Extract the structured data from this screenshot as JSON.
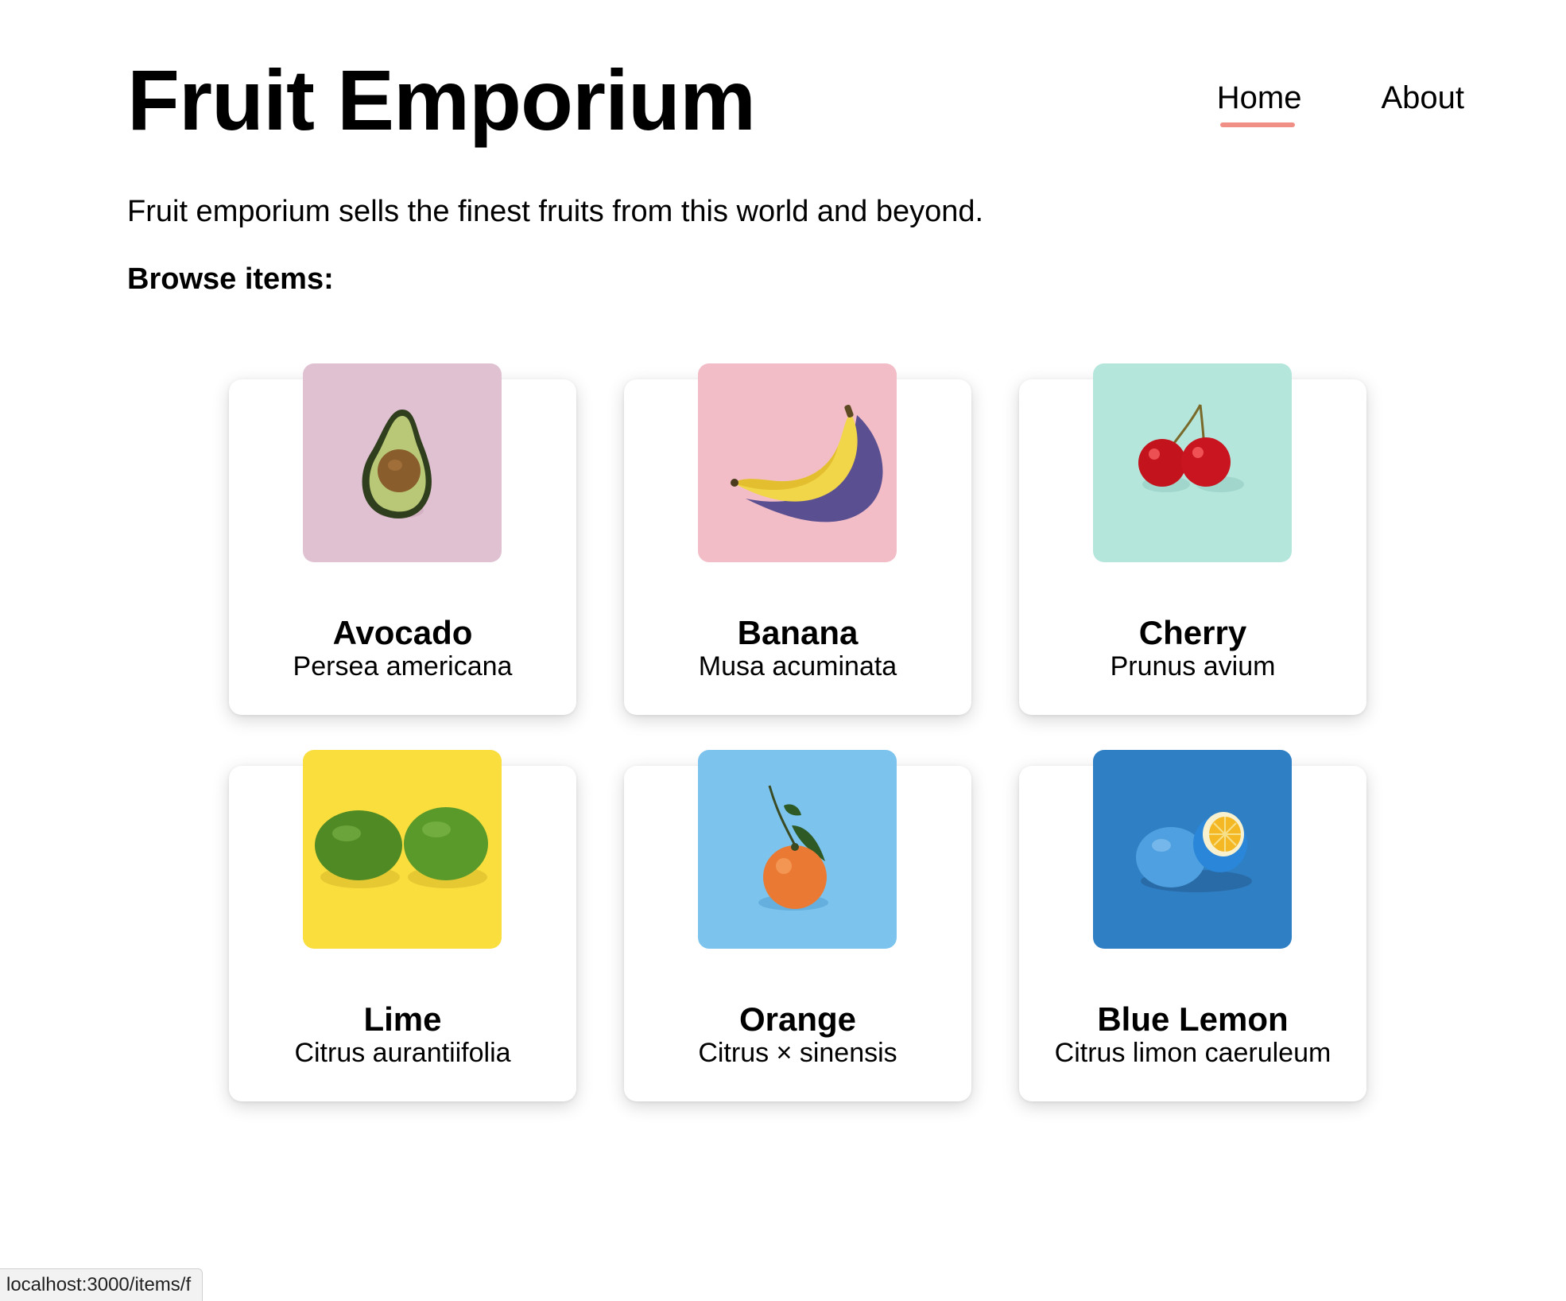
{
  "header": {
    "title": "Fruit Emporium",
    "nav": [
      {
        "label": "Home",
        "active": true
      },
      {
        "label": "About",
        "active": false
      }
    ]
  },
  "intro": "Fruit emporium sells the finest fruits from this world and beyond.",
  "browse_heading": "Browse items:",
  "items": [
    {
      "name": "Avocado",
      "latin": "Persea americana",
      "image_bg": "#e0c1d2"
    },
    {
      "name": "Banana",
      "latin": "Musa acuminata",
      "image_bg": "#f2bdc6"
    },
    {
      "name": "Cherry",
      "latin": "Prunus avium",
      "image_bg": "#b4e6dc"
    },
    {
      "name": "Lime",
      "latin": "Citrus aurantiifolia",
      "image_bg": "#f9de3e"
    },
    {
      "name": "Orange",
      "latin": "Citrus × sinensis",
      "image_bg": "#7cc4ee"
    },
    {
      "name": "Blue Lemon",
      "latin": "Citrus limon caeruleum",
      "image_bg": "#2f7fc4"
    }
  ],
  "colors": {
    "nav_active_underline": "#f08f86"
  },
  "status_bar": {
    "url": "localhost:3000/items/f"
  }
}
